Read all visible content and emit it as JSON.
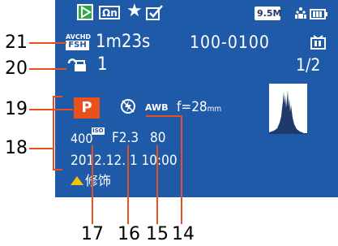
{
  "top_bar": {
    "megapixels": "9.5M",
    "badge_text": "Ωn"
  },
  "row1": {
    "avchd_top": "AVCHD",
    "avchd_bottom": "FSH",
    "duration": "1m23s",
    "folder_file": "100-0100"
  },
  "row2": {
    "print_count": "1",
    "page": "1/2"
  },
  "info_block": {
    "mode": "P",
    "wb": "AWB",
    "focal_length": "f=28",
    "focal_unit": "mm",
    "iso_value": "400",
    "iso_label": "ISO",
    "aperture": "F2.3",
    "shutter": "80",
    "datetime": "2012.12. 1 10:00",
    "retouch_label": "修饰"
  },
  "callouts": {
    "c21": "21",
    "c20": "20",
    "c19": "19",
    "c18": "18",
    "c17": "17",
    "c16": "16",
    "c15": "15",
    "c14": "14"
  },
  "colors": {
    "screen_bg": "#1f5aa8",
    "accent_orange": "#e8501e",
    "play_green": "#2fa84a",
    "warn_yellow": "#f5c400"
  }
}
